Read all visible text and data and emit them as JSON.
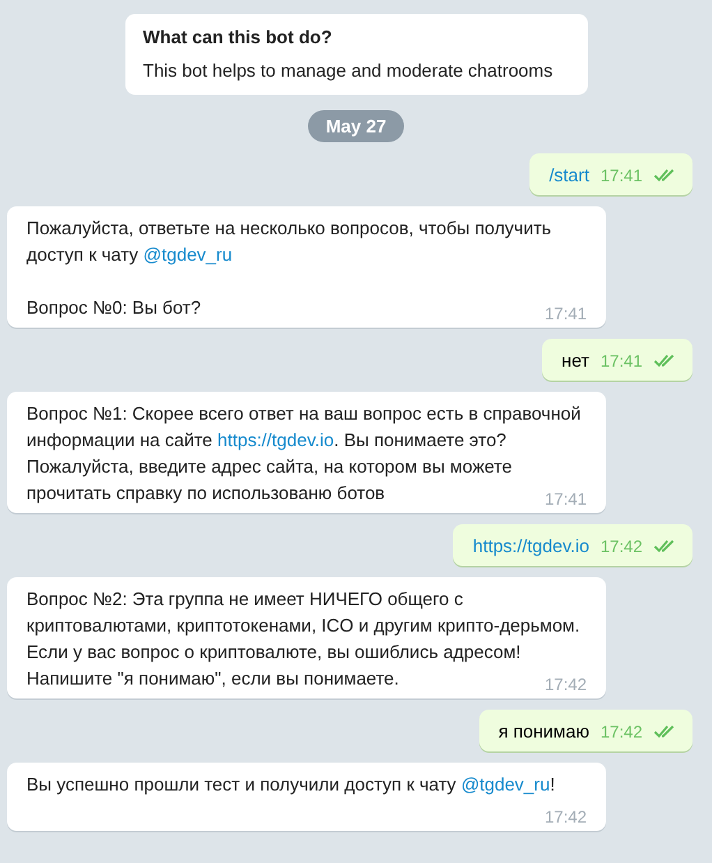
{
  "bot_info": {
    "title": "What can this bot do?",
    "description": "This bot helps to manage and moderate chatrooms"
  },
  "date_badge": "May 27",
  "messages": [
    {
      "kind": "out",
      "parts": [
        {
          "kind": "link",
          "text": "/start"
        }
      ],
      "time": "17:41",
      "read": true
    },
    {
      "kind": "in",
      "parts": [
        {
          "kind": "text",
          "text": "Пожалуйста, ответьте на несколько вопросов, чтобы получить доступ к чату "
        },
        {
          "kind": "link",
          "text": "@tgdev_ru"
        },
        {
          "kind": "text",
          "text": "\n\nВопрос №0: Вы бот?"
        }
      ],
      "time": "17:41"
    },
    {
      "kind": "out",
      "parts": [
        {
          "kind": "text",
          "text": "нет"
        }
      ],
      "time": "17:41",
      "read": true
    },
    {
      "kind": "in",
      "parts": [
        {
          "kind": "text",
          "text": "Вопрос №1: Скорее всего ответ на ваш вопрос есть в справочной информации на сайте "
        },
        {
          "kind": "link",
          "text": "https://tgdev.io"
        },
        {
          "kind": "text",
          "text": ". Вы понимаете это? Пожалуйста, введите адрес сайта, на котором вы можете прочитать справку по использованю ботов"
        }
      ],
      "time": "17:41"
    },
    {
      "kind": "out",
      "parts": [
        {
          "kind": "link",
          "text": "https://tgdev.io"
        }
      ],
      "time": "17:42",
      "read": true
    },
    {
      "kind": "in",
      "parts": [
        {
          "kind": "text",
          "text": "Вопрос №2: Эта группа не имеет НИЧЕГО общего с криптовалютами, криптотокенами, ICO и другим крипто-дерьмом. Если у вас вопрос о криптовалюте, вы ошиблись адресом! Напишите \"я понимаю\", если вы понимаете."
        }
      ],
      "time": "17:42"
    },
    {
      "kind": "out",
      "parts": [
        {
          "kind": "text",
          "text": "я понимаю"
        }
      ],
      "time": "17:42",
      "read": true
    },
    {
      "kind": "in",
      "parts": [
        {
          "kind": "text",
          "text": "Вы успешно прошли тест и получили доступ к чату "
        },
        {
          "kind": "link",
          "text": "@tgdev_ru"
        },
        {
          "kind": "text",
          "text": "!"
        }
      ],
      "time": "17:42"
    }
  ]
}
